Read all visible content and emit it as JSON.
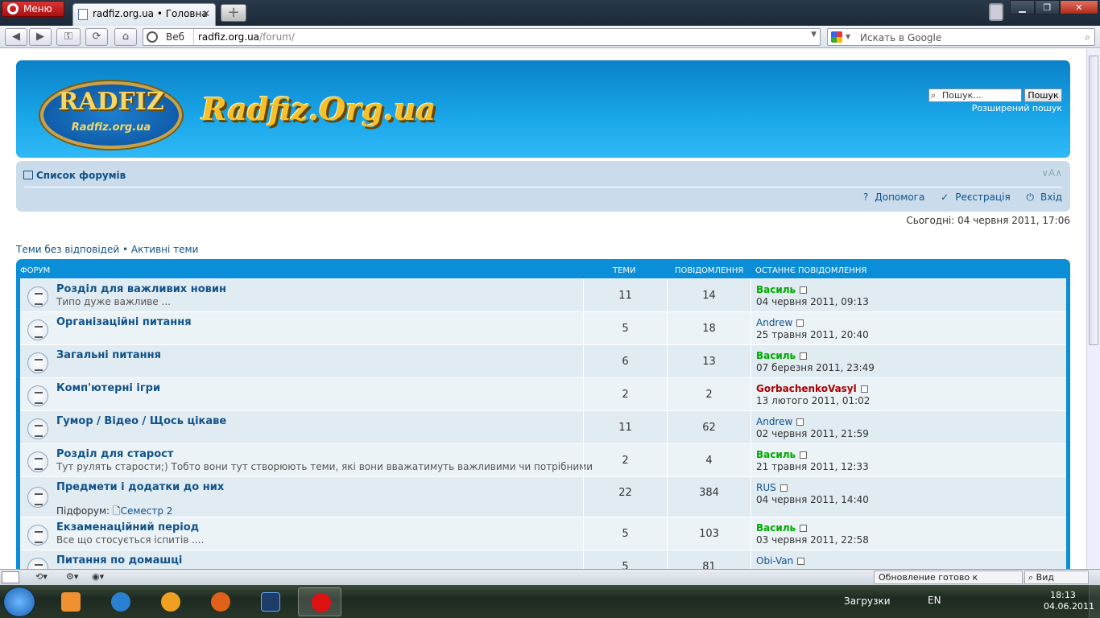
{
  "browser": {
    "menu_label": "Меню",
    "tab_title": "radfiz.org.ua • Головна",
    "address_scheme_label": "Веб",
    "address_domain": "radfiz.org.ua",
    "address_path": "/forum/",
    "search_placeholder": "Искать в Google"
  },
  "site": {
    "logo_text": "RADFIZ",
    "logo_subtext": "Radfiz.org.ua",
    "site_name": "Radfiz.Org.ua",
    "search_placeholder": "Пошук...",
    "search_button": "Пошук",
    "advanced_search": "Розширений пошук"
  },
  "nav": {
    "forum_index": "Список форумів",
    "font_size": "∨A∧",
    "help": "Допомога",
    "register": "Реєстрація",
    "login": "Вхід"
  },
  "today": "Сьогодні: 04 червня 2011, 17:06",
  "quicklinks": {
    "unanswered": "Теми без відповідей",
    "sep": " • ",
    "active": "Активні теми"
  },
  "table": {
    "headers": {
      "forum": "Форум",
      "topics": "Теми",
      "posts": "Повідомлення",
      "last_post": "Останнє повідомлення"
    },
    "rows": [
      {
        "name": "Розділ для важливих новин",
        "desc": "Типо дуже важливе ...",
        "topics": "11",
        "posts": "14",
        "user": "Василь",
        "date": "04 червня 2011, 09:13"
      },
      {
        "name": "Організаційні питання",
        "desc": "",
        "topics": "5",
        "posts": "18",
        "user": "Andrew",
        "date": "25 травня 2011, 20:40"
      },
      {
        "name": "Загальні питання",
        "desc": "",
        "topics": "6",
        "posts": "13",
        "user": "Василь",
        "date": "07 березня 2011, 23:49"
      },
      {
        "name": "Комп'ютерні ігри",
        "desc": "",
        "topics": "2",
        "posts": "2",
        "user": "GorbachenkoVasyl",
        "date": "13 лютого 2011, 01:02"
      },
      {
        "name": "Гумор / Відео / Щось цікаве",
        "desc": "",
        "topics": "11",
        "posts": "62",
        "user": "Andrew",
        "date": "02 червня 2011, 21:59"
      },
      {
        "name": "Розділ для старост",
        "desc": "Тут рулять старости;) Тобто вони тут створюють теми, які вони вважатимуть важливими чи потрібними",
        "topics": "2",
        "posts": "4",
        "user": "Василь",
        "date": "21 травня 2011, 12:33"
      },
      {
        "name": "Предмети і додатки до них",
        "desc": "",
        "subforum_label": "Підфорум:",
        "subforum": "Семестр 2",
        "topics": "22",
        "posts": "384",
        "user": "RUS",
        "date": "04 червня 2011, 14:40"
      },
      {
        "name": "Екзаменаційний період",
        "desc": "Все що стосується іспитів ....",
        "topics": "5",
        "posts": "103",
        "user": "Василь",
        "date": "03 червня 2011, 22:58"
      },
      {
        "name": "Питання по домашці",
        "desc": "",
        "topics": "5",
        "posts": "81",
        "user": "Obi-Van",
        "date": ""
      }
    ]
  },
  "statusbar": {
    "update": "Обновление готово к установке",
    "zoom": "Вид (100%)"
  },
  "taskbar": {
    "downloads": "Загрузки",
    "lang": "EN",
    "time": "18:13",
    "date": "04.06.2011"
  },
  "colors": {
    "header_blue": "#1aa7ea",
    "link_blue": "#105289",
    "user_green": "#00aa00",
    "user_red": "#aa0000"
  }
}
